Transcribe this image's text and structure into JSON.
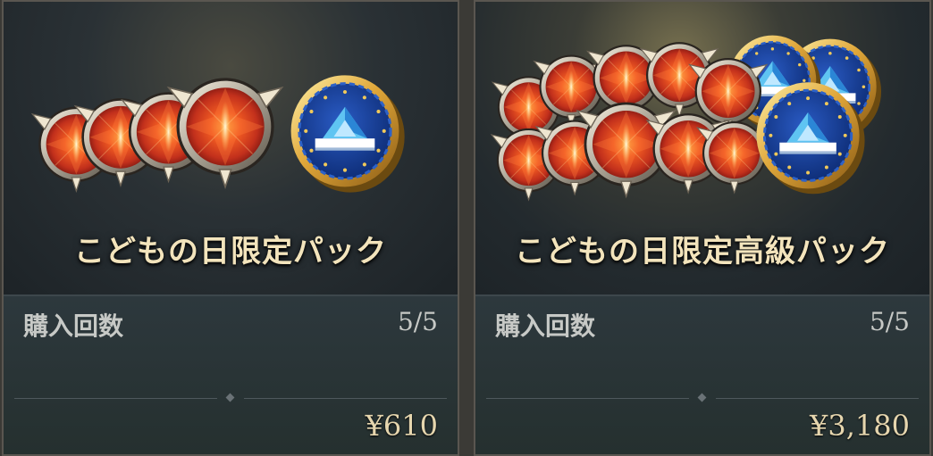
{
  "cards": [
    {
      "title": "こどもの日限定パック",
      "purchase_label": "購入回数",
      "purchase_count": "5/5",
      "price": "¥610"
    },
    {
      "title": "こどもの日限定高級パック",
      "purchase_label": "購入回数",
      "purchase_count": "5/5",
      "price": "¥3,180"
    }
  ],
  "colors": {
    "title_gold": "#f3e4bc",
    "gem_red": "#d8442a",
    "coin_blue": "#17409a",
    "coin_gold": "#d9a93a"
  },
  "icons": [
    "red-gem-icon",
    "kabuto-coin-icon"
  ]
}
